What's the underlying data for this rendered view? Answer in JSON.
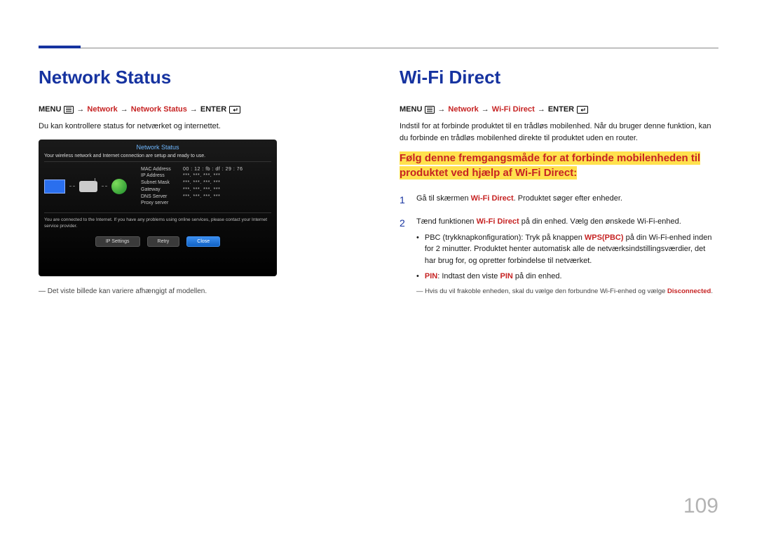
{
  "page_number": "109",
  "left": {
    "heading": "Network Status",
    "nav": {
      "menu": "MENU",
      "path1": "Network",
      "path2": "Network Status",
      "enter": "ENTER"
    },
    "body": "Du kan kontrollere status for netværket og internettet.",
    "ui": {
      "title": "Network Status",
      "subtitle": "Your wireless network and Internet connection are setup and ready to use.",
      "table": {
        "mac": {
          "label": "MAC Address",
          "value": "00 : 12 : fb : df : 29 : 76"
        },
        "ip": {
          "label": "IP Address",
          "value": "***. ***. ***. ***"
        },
        "subnet": {
          "label": "Subnet Mask",
          "value": "***. ***. ***. ***"
        },
        "gateway": {
          "label": "Gateway",
          "value": "***. ***. ***. ***"
        },
        "dns": {
          "label": "DNS Server",
          "value": "***. ***. ***. ***"
        },
        "proxy": {
          "label": "Proxy server",
          "value": ""
        }
      },
      "footnote": "You are connected to the Internet. If you have any problems using online services, please contact your Internet service provider.",
      "buttons": {
        "ip": "IP Settings",
        "retry": "Retry",
        "close": "Close"
      }
    },
    "caption": "Det viste billede kan variere afhængigt af modellen."
  },
  "right": {
    "heading": "Wi-Fi Direct",
    "nav": {
      "menu": "MENU",
      "path1": "Network",
      "path2": "Wi-Fi Direct",
      "enter": "ENTER"
    },
    "body": "Indstil for at forbinde produktet til en trådløs mobilenhed. Når du bruger denne funktion, kan du forbinde en trådløs mobilenhed direkte til produktet uden en router.",
    "highlight": "Følg denne fremgangsmåde for at forbinde mobilenheden til produktet ved hjælp af Wi-Fi Direct:",
    "step1": {
      "pre": "Gå til skærmen ",
      "bold": "Wi-Fi Direct",
      "post": ". Produktet søger efter enheder."
    },
    "step2": {
      "pre": "Tænd funktionen ",
      "bold": "Wi-Fi Direct",
      "post": " på din enhed. Vælg den ønskede Wi-Fi-enhed.",
      "bullet1_pre": "PBC (trykknapkonfiguration): Tryk på knappen ",
      "bullet1_bold": "WPS(PBC)",
      "bullet1_post": " på din Wi-Fi-enhed inden for 2 minutter. Produktet henter automatisk alle de netværksindstillingsværdier, det har brug for, og opretter forbindelse til netværket.",
      "bullet2_bold1": "PIN",
      "bullet2_mid": ": Indtast den viste ",
      "bullet2_bold2": "PIN",
      "bullet2_post": " på din enhed."
    },
    "footnote_pre": "Hvis du vil frakoble enheden, skal du vælge den forbundne Wi-Fi-enhed og vælge ",
    "footnote_bold": "Disconnected",
    "footnote_post": "."
  }
}
